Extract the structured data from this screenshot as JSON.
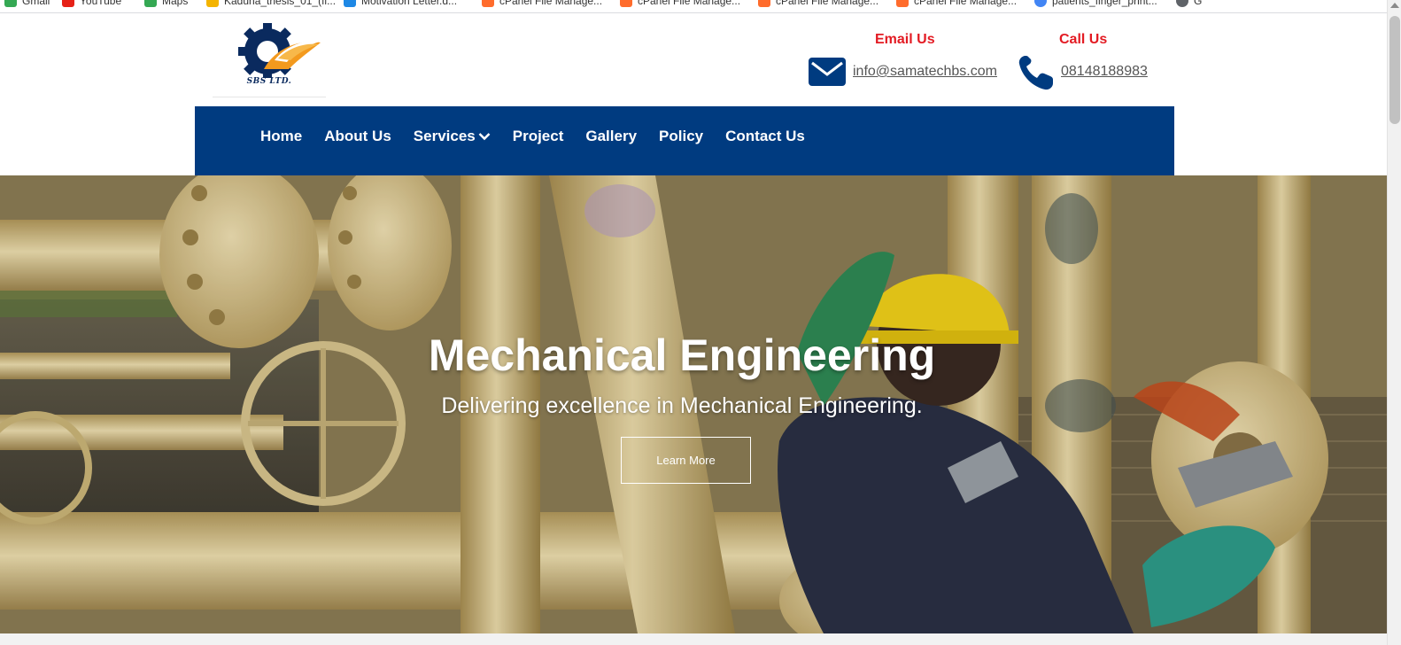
{
  "bookmarks": [
    {
      "label": "Gmail",
      "color": "#34a853"
    },
    {
      "label": "YouTube",
      "color": "#e62117"
    },
    {
      "label": "Maps",
      "color": "#34a853"
    },
    {
      "label": "Kaduna_thesis_01_(fi...",
      "color": "#f4b400"
    },
    {
      "label": "Motivation Letter.d...",
      "color": "#1e88e5"
    },
    {
      "label": "cPanel File Manage...",
      "color": "#ff6c2c"
    },
    {
      "label": "cPanel File Manage...",
      "color": "#ff6c2c"
    },
    {
      "label": "cPanel File Manage...",
      "color": "#ff6c2c"
    },
    {
      "label": "cPanel File Manage...",
      "color": "#ff6c2c"
    },
    {
      "label": "patients_finger_print...",
      "color": "#4285f4"
    },
    {
      "label": "G",
      "color": "#5f6368"
    }
  ],
  "logo": {
    "text": "SBS LTD."
  },
  "contact": {
    "email_title": "Email Us",
    "email_value": "info@samatechbs.com",
    "call_title": "Call Us",
    "call_value": "08148188983"
  },
  "nav": {
    "items": [
      {
        "label": "Home"
      },
      {
        "label": "About Us"
      },
      {
        "label": "Services",
        "has_dropdown": true
      },
      {
        "label": "Project"
      },
      {
        "label": "Gallery"
      },
      {
        "label": "Policy"
      },
      {
        "label": "Contact Us"
      }
    ]
  },
  "hero": {
    "title": "Mechanical Engineering",
    "subtitle": "Delivering excellence in Mechanical Engineering.",
    "button_label": "Learn More"
  },
  "colors": {
    "nav_bg": "#003b80",
    "accent_red": "#e31b23",
    "logo_navy": "#0a2a5e",
    "logo_orange": "#f39a1e"
  }
}
